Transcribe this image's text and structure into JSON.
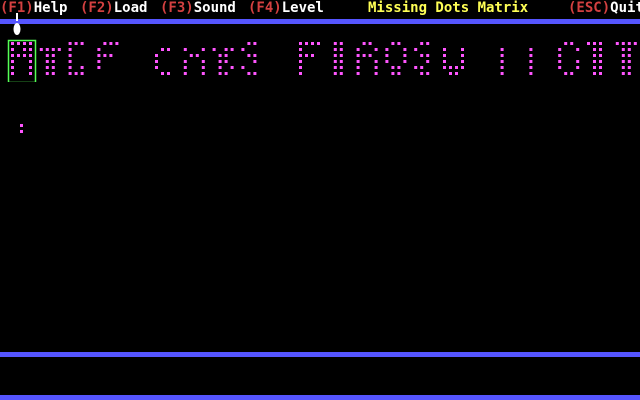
{
  "menu": {
    "items": [
      {
        "key": "(F1)",
        "label": "Help"
      },
      {
        "key": "(F2)",
        "label": "Load"
      },
      {
        "key": "(F3)",
        "label": "Sound"
      },
      {
        "key": "(F4)",
        "label": "Level"
      }
    ],
    "quit": {
      "key": "(ESC)",
      "label": "Quit"
    }
  },
  "title": "Missing Dots Matrix",
  "colors": {
    "background": "#000000",
    "bar": "#5555ff",
    "key": "#d24040",
    "label": "#ffffff",
    "title": "#ffff55",
    "dot": "#ff55ff",
    "selection": "#55ff55",
    "pointer": "#ffffff"
  },
  "puzzle": {
    "selected_cell": 0,
    "cells": [
      [
        "1111",
        "1011",
        "1111",
        "1001",
        "1001",
        "1001"
      ],
      [
        "0000",
        "1111",
        "0110",
        "0110",
        "0110",
        "0110"
      ],
      [
        "1110",
        "1000",
        "1000",
        "1000",
        "1010",
        "1110"
      ],
      [
        "0111",
        "1000",
        "1110",
        "1000",
        "1000",
        "0000"
      ],
      [
        "space"
      ],
      [
        "0000",
        "0110",
        "1000",
        "1000",
        "1000",
        "0110"
      ],
      [
        "0000",
        "1001",
        "0110",
        "1001",
        "1001",
        "1001"
      ],
      [
        "0000",
        "1011",
        "0110",
        "0110",
        "0101",
        "0110"
      ],
      [
        "0110",
        "1000",
        "0110",
        "0010",
        "1000",
        "0110"
      ],
      [
        "space"
      ],
      [
        "1111",
        "1000",
        "1110",
        "1000",
        "1000",
        "1000"
      ],
      [
        "0110",
        "0110",
        "0110",
        "0110",
        "0110",
        "0110"
      ],
      [
        "0110",
        "1001",
        "1110",
        "1001",
        "1001",
        "1001"
      ],
      [
        "0110",
        "1001",
        "1001",
        "1001",
        "0110",
        "0110"
      ],
      [
        "0110",
        "1000",
        "0110",
        "0010",
        "1100",
        "0110"
      ],
      [
        "0000",
        "1001",
        "1001",
        "1001",
        "1111",
        "0110"
      ],
      [
        "space"
      ],
      [
        "0000",
        "1000",
        "1000",
        "1000",
        "1000",
        "1000"
      ],
      [
        "0000",
        "1000",
        "1000",
        "1000",
        "1000",
        "1000"
      ],
      [
        "0110",
        "1001",
        "1000",
        "1001",
        "1001",
        "0110"
      ],
      [
        "1110",
        "0110",
        "0110",
        "0110",
        "0110",
        "0110"
      ],
      [
        "1111",
        "0110",
        "0110",
        "0110",
        "0110",
        "0110"
      ]
    ]
  }
}
